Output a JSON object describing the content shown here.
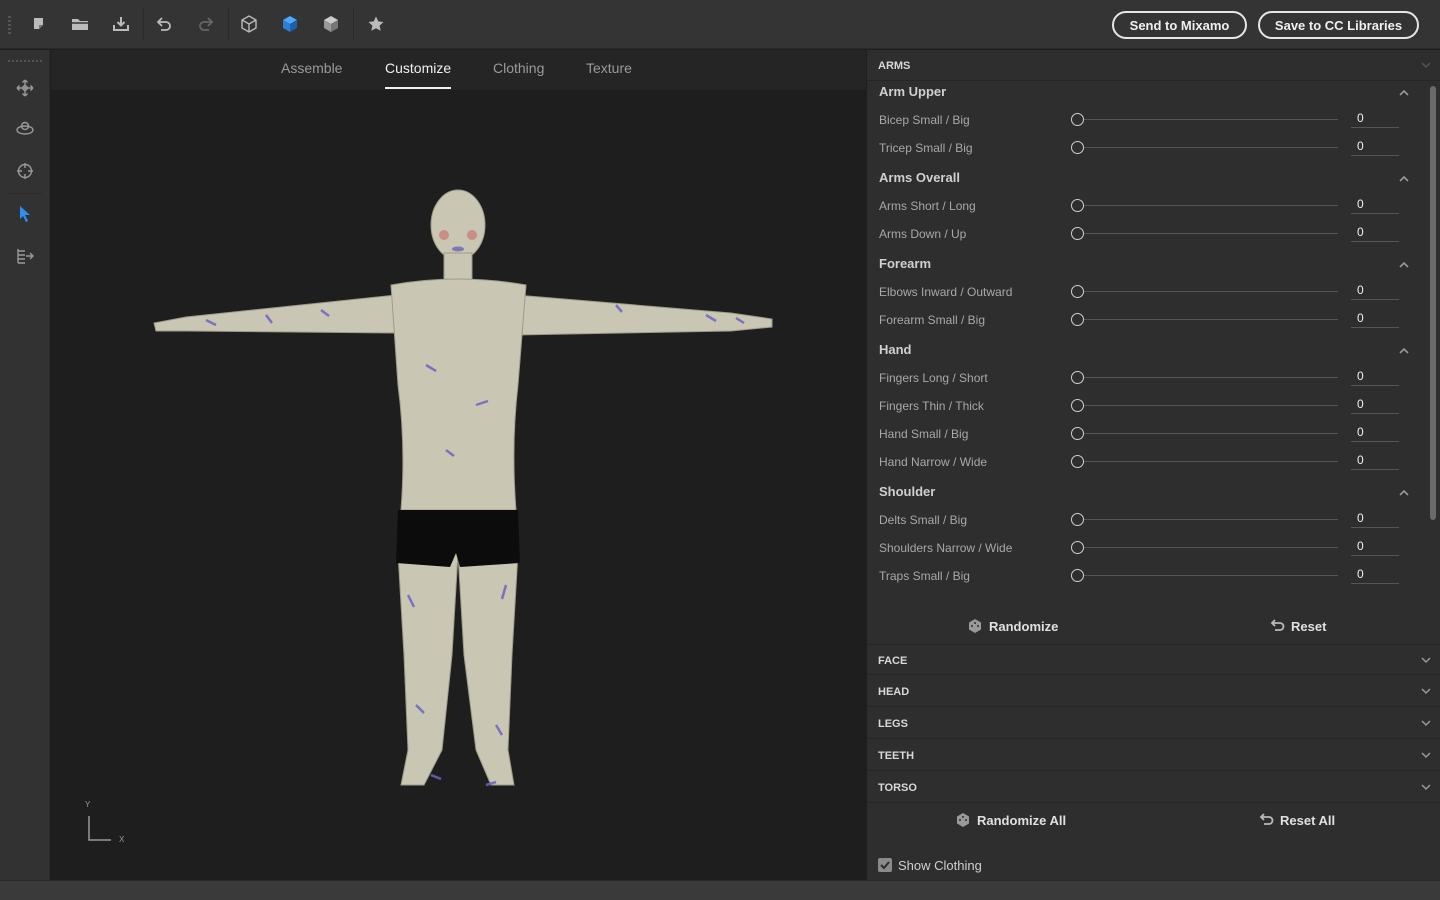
{
  "toolbar": {
    "icons": [
      "new-file-icon",
      "open-folder-icon",
      "download-icon",
      "undo-icon",
      "redo-icon",
      "cube-outline-icon",
      "cube-blue-icon",
      "cube-solid-icon",
      "star-icon"
    ],
    "send_button": "Send to Mixamo",
    "save_button": "Save to CC Libraries"
  },
  "left_tools": [
    "move-icon",
    "orbit-icon",
    "target-icon",
    "pointer-icon",
    "export-icon"
  ],
  "tabs": [
    {
      "label": "Assemble",
      "active": false
    },
    {
      "label": "Customize",
      "active": true
    },
    {
      "label": "Clothing",
      "active": false
    },
    {
      "label": "Texture",
      "active": false
    }
  ],
  "axis": {
    "y": "Y",
    "x": "X"
  },
  "panel": {
    "arms_title": "ARMS",
    "groups": [
      {
        "title": "Arm Upper",
        "rows": [
          {
            "label": "Bicep Small / Big",
            "value": "0"
          },
          {
            "label": "Tricep Small / Big",
            "value": "0"
          }
        ]
      },
      {
        "title": "Arms Overall",
        "rows": [
          {
            "label": "Arms Short / Long",
            "value": "0"
          },
          {
            "label": "Arms Down / Up",
            "value": "0"
          }
        ]
      },
      {
        "title": "Forearm",
        "rows": [
          {
            "label": "Elbows Inward / Outward",
            "value": "0"
          },
          {
            "label": "Forearm Small / Big",
            "value": "0"
          }
        ]
      },
      {
        "title": "Hand",
        "rows": [
          {
            "label": "Fingers Long / Short",
            "value": "0"
          },
          {
            "label": "Fingers Thin / Thick",
            "value": "0"
          },
          {
            "label": "Hand Small / Big",
            "value": "0"
          },
          {
            "label": "Hand Narrow / Wide",
            "value": "0"
          }
        ]
      },
      {
        "title": "Shoulder",
        "rows": [
          {
            "label": "Delts Small / Big",
            "value": "0"
          },
          {
            "label": "Shoulders Narrow / Wide",
            "value": "0"
          },
          {
            "label": "Traps Small / Big",
            "value": "0"
          }
        ]
      }
    ],
    "randomize": "Randomize",
    "reset": "Reset",
    "sections": [
      "FACE",
      "HEAD",
      "LEGS",
      "TEETH",
      "TORSO"
    ],
    "randomize_all": "Randomize All",
    "reset_all": "Reset All",
    "show_clothing": "Show Clothing",
    "show_clothing_checked": true
  }
}
